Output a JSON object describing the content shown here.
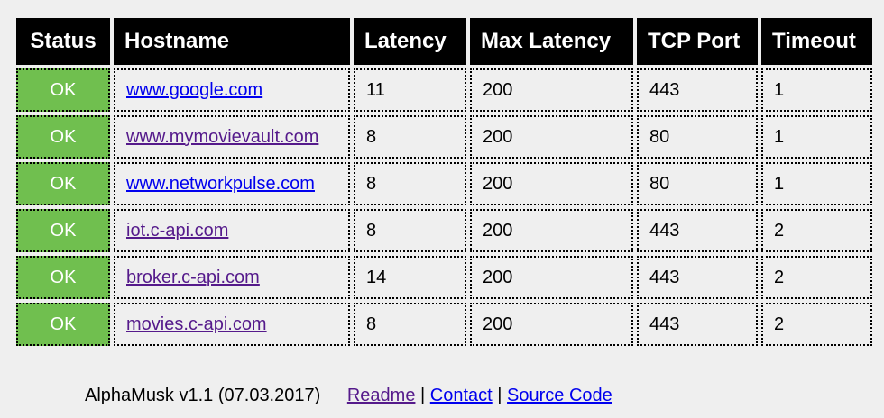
{
  "table": {
    "headers": {
      "status": "Status",
      "hostname": "Hostname",
      "latency": "Latency",
      "max_latency": "Max Latency",
      "tcp_port": "TCP Port",
      "timeout": "Timeout"
    },
    "rows": [
      {
        "status": "OK",
        "hostname": "www.google.com",
        "latency": "11",
        "max_latency": "200",
        "tcp_port": "443",
        "timeout": "1",
        "link_state": "fresh"
      },
      {
        "status": "OK",
        "hostname": "www.mymovievault.com",
        "latency": "8",
        "max_latency": "200",
        "tcp_port": "80",
        "timeout": "1",
        "link_state": "visited"
      },
      {
        "status": "OK",
        "hostname": "www.networkpulse.com",
        "latency": "8",
        "max_latency": "200",
        "tcp_port": "80",
        "timeout": "1",
        "link_state": "fresh"
      },
      {
        "status": "OK",
        "hostname": "iot.c-api.com",
        "latency": "8",
        "max_latency": "200",
        "tcp_port": "443",
        "timeout": "2",
        "link_state": "visited"
      },
      {
        "status": "OK",
        "hostname": "broker.c-api.com",
        "latency": "14",
        "max_latency": "200",
        "tcp_port": "443",
        "timeout": "2",
        "link_state": "visited"
      },
      {
        "status": "OK",
        "hostname": "movies.c-api.com",
        "latency": "8",
        "max_latency": "200",
        "tcp_port": "443",
        "timeout": "2",
        "link_state": "visited"
      }
    ]
  },
  "footer": {
    "version": "AlphaMusk v1.1 (07.03.2017)",
    "readme": "Readme",
    "contact": "Contact",
    "source_code": "Source Code",
    "separator": "|"
  },
  "colors": {
    "status_ok": "#70bf4f",
    "header_bg": "#000000",
    "page_bg": "#efefef",
    "link_visited": "#551a8b",
    "link_unvisited": "#0000ee"
  }
}
